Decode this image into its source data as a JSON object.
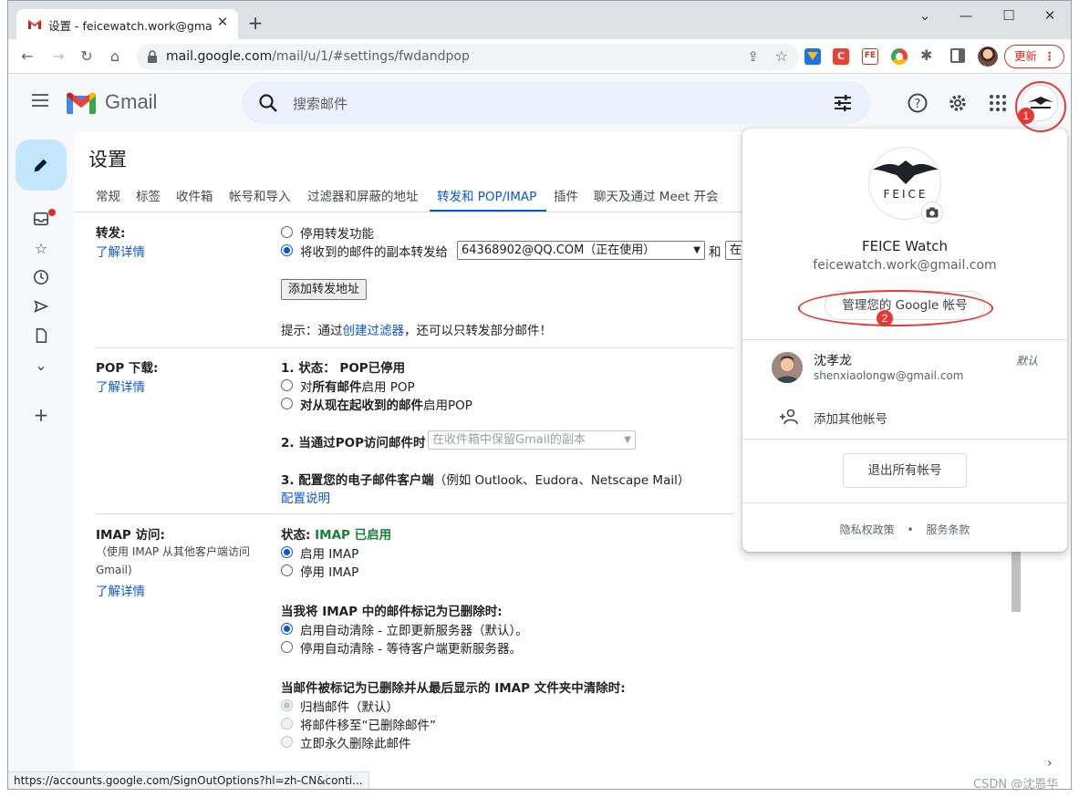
{
  "browser": {
    "tab_title": "设置 - feicewatch.work@gmail.com",
    "url_host": "mail.google.com",
    "url_path": "/mail/u/1/#settings/fwdandpop",
    "update_label": "更新",
    "status_url": "https://accounts.google.com/SignOutOptions?hl=zh-CN&conti..."
  },
  "header": {
    "app_name": "Gmail",
    "search_placeholder": "搜索邮件"
  },
  "settings": {
    "title": "设置",
    "tabs": [
      "常规",
      "标签",
      "收件箱",
      "帐号和导入",
      "过滤器和屏蔽的地址",
      "转发和 POP/IMAP",
      "插件",
      "聊天及通过 Meet 开会"
    ],
    "active_tab": "转发和 POP/IMAP",
    "learn_more": "了解详情",
    "forwarding": {
      "label": "转发:",
      "disable_option": "停用转发功能",
      "forward_option": "将收到的邮件的副本转发给",
      "forward_address": "64368902@QQ.COM（正在使用）",
      "and_label": "和",
      "trailing_select": "在",
      "add_button": "添加转发地址",
      "tip_prefix": "提示：通过",
      "tip_link": "创建过滤器",
      "tip_suffix": "，还可以只转发部分邮件！"
    },
    "pop": {
      "label": "POP 下载:",
      "status_title": "1. 状态： POP已停用",
      "opt_all_pre": "对",
      "opt_all_bold": "所有邮件",
      "opt_all_post": "启用 POP",
      "opt_now_bold": "对从现在起收到的邮件",
      "opt_now_post": "启用POP",
      "access_title": "2. 当通过POP访问邮件时",
      "access_select": "在收件箱中保留Gmail的副本",
      "client_title": "3. 配置您的电子邮件客户端",
      "client_example": "（例如 Outlook、Eudora、Netscape Mail）",
      "config_link": "配置说明"
    },
    "imap": {
      "label": "IMAP 访问:",
      "note": "（使用 IMAP 从其他客户端访问 Gmail)",
      "status_prefix": "状态:",
      "status_value": "IMAP 已启用",
      "enable": "启用 IMAP",
      "disable": "停用 IMAP",
      "deleted_title": "当我将 IMAP 中的邮件标记为已删除时:",
      "auto_on": "启用自动清除 - 立即更新服务器（默认）。",
      "auto_off": "停用自动清除 - 等待客户端更新服务器。",
      "expunge_title": "当邮件被标记为已删除并从最后显示的 IMAP 文件夹中清除时:",
      "archive": "归档邮件（默认）",
      "move_trash": "将邮件移至“已删除邮件”",
      "delete_forever": "立即永久删除此邮件"
    }
  },
  "account_popup": {
    "brand_text": "FEICE",
    "name": "FEICE Watch",
    "email": "feicewatch.work@gmail.com",
    "manage_button": "管理您的 Google 帐号",
    "other_account": {
      "name": "沈孝龙",
      "email": "shenxiaolongw@gmail.com",
      "default_tag": "默认"
    },
    "add_account": "添加其他帐号",
    "signout_all": "退出所有帐号",
    "privacy": "隐私权政策",
    "footer_dot": "•",
    "terms": "服务条款"
  },
  "annotations": [
    "1",
    "2"
  ],
  "watermark": "CSDN @沈恩华",
  "colors": {
    "accent": "#0b57d0",
    "compose": "#c2e7ff",
    "annotation_red": "#e53935",
    "imap_green": "#188038"
  }
}
